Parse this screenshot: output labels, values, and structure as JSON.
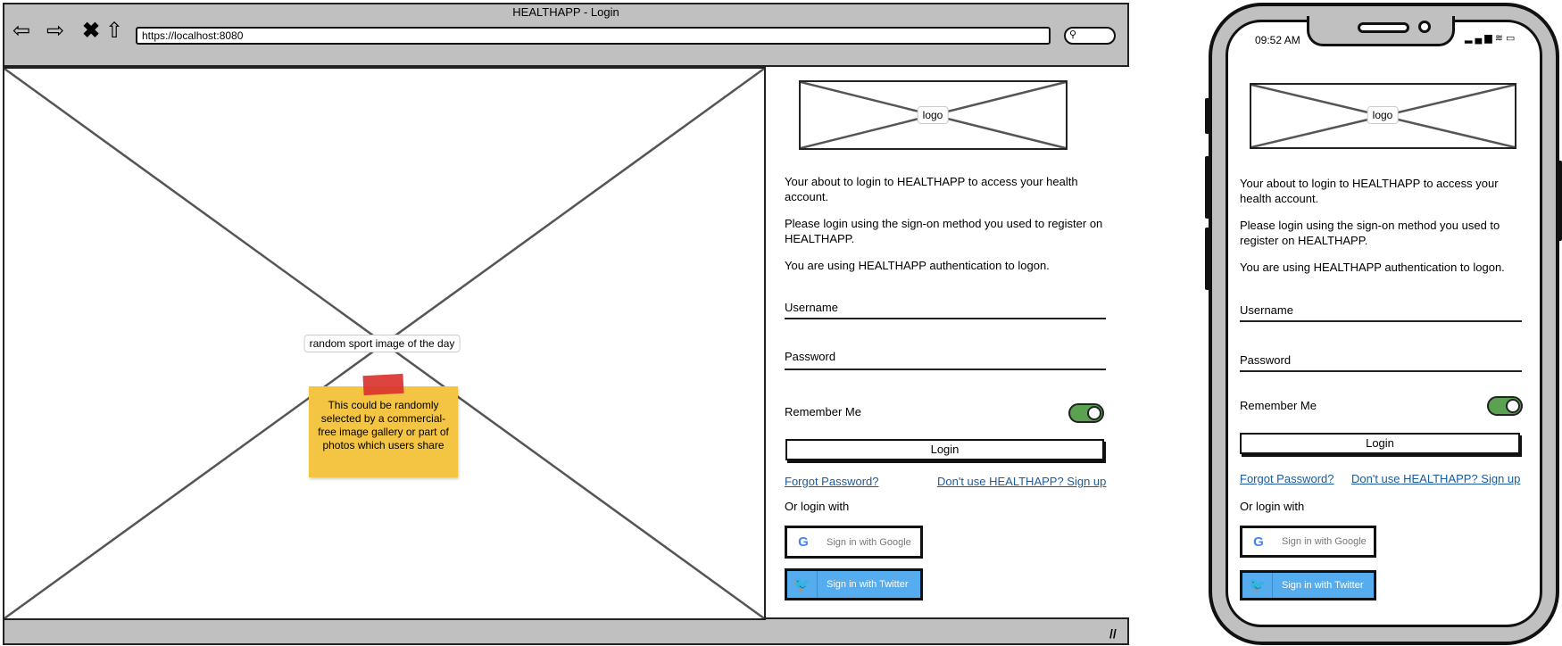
{
  "browser": {
    "title": "HEALTHAPP - Login",
    "url": "https://localhost:8080",
    "nav_icons": [
      "back-arrow-icon",
      "forward-arrow-icon",
      "close-icon",
      "home-icon"
    ]
  },
  "hero": {
    "image_label": "random sport image of the day",
    "sticky_note": "This could be randomly selected by a commercial-free image gallery or part of photos which users share"
  },
  "login": {
    "logo_label": "logo",
    "intro_1": "Your about to login to HEALTHAPP to access your health account.",
    "intro_2": "Please login using the sign-on method you used to register on HEALTHAPP.",
    "intro_3": "You are using HEALTHAPP authentication to logon.",
    "username_label": "Username",
    "password_label": "Password",
    "remember_label": "Remember Me",
    "remember_on": true,
    "login_button": "Login",
    "forgot_link": "Forgot Password?",
    "signup_link": "Don't use HEALTHAPP? Sign up",
    "or_login_with": "Or login with",
    "google_button": "Sign in with Google",
    "twitter_button": "Sign in with Twitter"
  },
  "phone": {
    "time": "09:52 AM"
  },
  "colors": {
    "toggle_on": "#5aa152",
    "twitter": "#55acee",
    "link": "#1a5b9c",
    "sticky": "#f4c542",
    "tape": "#d9302b"
  }
}
